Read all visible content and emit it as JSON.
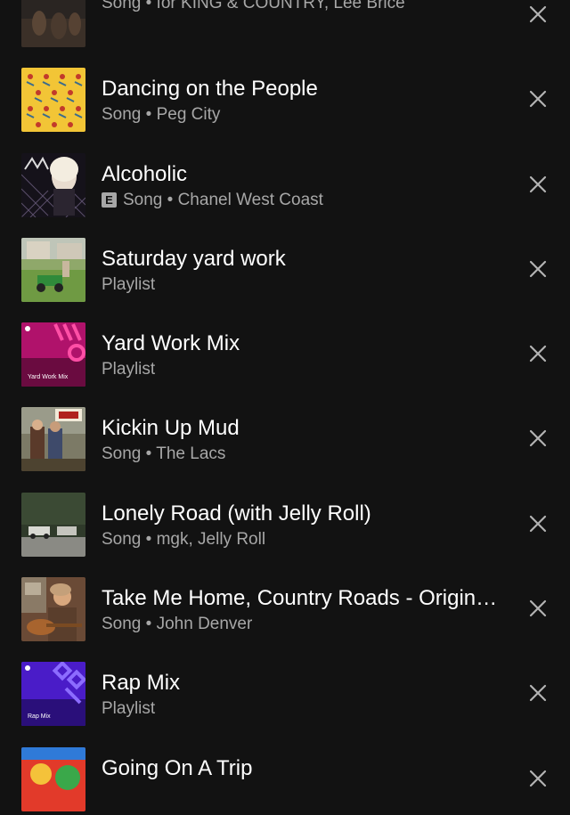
{
  "items": [
    {
      "title": "",
      "explicit": false,
      "sub": "Song • for KING & COUNTRY, Lee Brice",
      "art": "dark-group"
    },
    {
      "title": "Dancing on the People",
      "explicit": false,
      "sub": "Song • Peg City",
      "art": "yellow-pattern"
    },
    {
      "title": "Alcoholic",
      "explicit": true,
      "explicit_label": "E",
      "sub": "Song • Chanel West Coast",
      "art": "alcoholic"
    },
    {
      "title": "Saturday yard work",
      "explicit": false,
      "sub": "Playlist",
      "art": "lawn"
    },
    {
      "title": "Yard Work Mix",
      "explicit": false,
      "sub": "Playlist",
      "art": "mix-magenta",
      "cover_text": "Yard Work Mix"
    },
    {
      "title": "Kickin Up Mud",
      "explicit": false,
      "sub": "Song • The Lacs",
      "art": "lacs"
    },
    {
      "title": "Lonely Road (with Jelly Roll)",
      "explicit": false,
      "sub": "Song • mgk, Jelly Roll",
      "art": "road"
    },
    {
      "title": "Take Me Home, Country Roads - Original...",
      "explicit": false,
      "sub": "Song • John Denver",
      "art": "denver"
    },
    {
      "title": "Rap Mix",
      "explicit": false,
      "sub": "Playlist",
      "art": "mix-purple",
      "cover_text": "Rap Mix"
    },
    {
      "title": "Going On A Trip",
      "explicit": false,
      "sub": "",
      "art": "trip"
    }
  ],
  "colors": {
    "background": "#121212",
    "title": "#ffffff",
    "subtitle": "#a7a7a7",
    "close_icon": "#b3b3b3"
  },
  "icons": {
    "remove": "close-icon",
    "explicit": "explicit-badge"
  }
}
